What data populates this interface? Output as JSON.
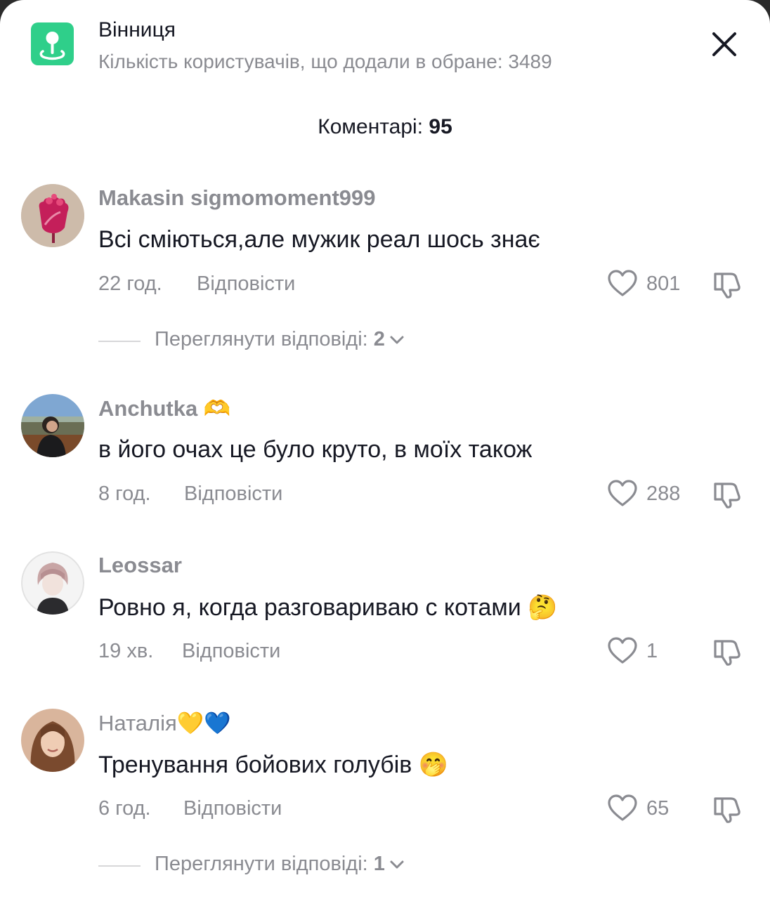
{
  "header": {
    "place_name": "Вінниця",
    "favorites_text": "Кількість користувачів, що додали в обране: 3489",
    "comments_label": "Коментарі:",
    "comments_count": "95"
  },
  "comments": [
    {
      "username": "Makasin sigmomoment999",
      "username_emoji": "",
      "text": "Всі сміються,але мужик реал шось знає",
      "text_emoji": "",
      "time": "22 год.",
      "reply_label": "Відповісти",
      "likes": "801",
      "view_replies_label": "Переглянути відповіді:",
      "view_replies_count": "2"
    },
    {
      "username": "Anchutka",
      "username_emoji": "🫶",
      "text": "в його очах це було круто, в моїх також",
      "text_emoji": "",
      "time": "8 год.",
      "reply_label": "Відповісти",
      "likes": "288"
    },
    {
      "username": "Leossar",
      "username_emoji": "",
      "text": "Ровно я, когда разговариваю с котами",
      "text_emoji": "🤔",
      "time": "19 хв.",
      "reply_label": "Відповісти",
      "likes": "1"
    },
    {
      "username": "Наталія",
      "username_emoji": "💛💙",
      "text": "Тренування бойових голубів",
      "text_emoji": "🤭",
      "time": "6 год.",
      "reply_label": "Відповісти",
      "likes": "65",
      "view_replies_label": "Переглянути відповіді:",
      "view_replies_count": "1"
    }
  ],
  "icons": {
    "place": "map-pin-icon",
    "close": "close-icon",
    "like": "heart-icon",
    "dislike": "thumbs-down-icon",
    "expand": "chevron-down-icon"
  },
  "colors": {
    "accent_green": "#2fcf8a",
    "text_primary": "#161823",
    "text_secondary": "#8a8b91"
  }
}
